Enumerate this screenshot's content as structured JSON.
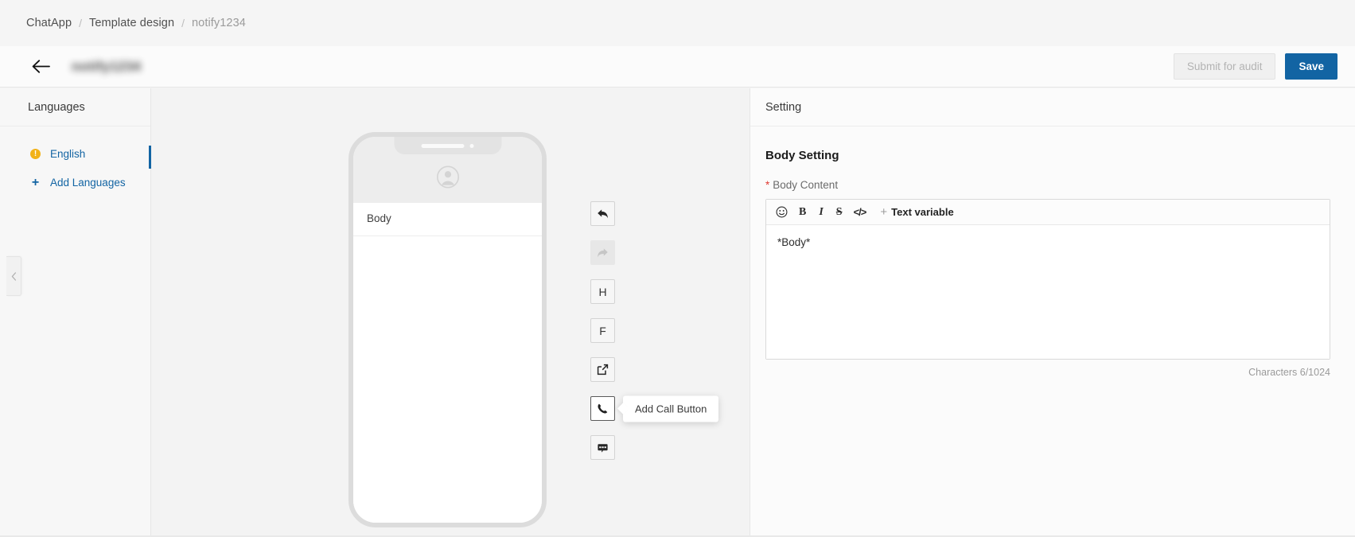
{
  "breadcrumb": {
    "items": [
      {
        "label": "ChatApp",
        "current": false
      },
      {
        "label": "Template design",
        "current": false
      },
      {
        "label": "notify1234",
        "current": true
      }
    ],
    "separator": "/"
  },
  "titlebar": {
    "back_icon": "arrow-left-icon",
    "title": "notify1234",
    "submit_label": "Submit for audit",
    "save_label": "Save",
    "primary_color": "#1264a3"
  },
  "languages": {
    "header": "Languages",
    "items": [
      {
        "label": "English",
        "status_icon": "warning-icon",
        "status_color": "#f2b218",
        "active": true
      },
      {
        "label": "Add Languages",
        "status_icon": "plus-icon",
        "status_color": "#1264a3",
        "active": false
      }
    ]
  },
  "collapse": {
    "icon": "chevron-left-icon"
  },
  "preview": {
    "avatar_icon": "user-avatar-icon",
    "body_text": "Body"
  },
  "tools": [
    {
      "name": "add-reply-button",
      "icon": "reply-arrow-icon",
      "label": "",
      "state": "default"
    },
    {
      "name": "add-forward-button",
      "icon": "forward-arrow-icon",
      "label": "",
      "state": "disabled"
    },
    {
      "name": "add-header",
      "icon": "letter-h",
      "label": "H",
      "state": "default"
    },
    {
      "name": "add-footer",
      "icon": "letter-f",
      "label": "F",
      "state": "default"
    },
    {
      "name": "add-url-button",
      "icon": "external-link-icon",
      "label": "",
      "state": "default"
    },
    {
      "name": "add-call-button",
      "icon": "phone-icon",
      "label": "",
      "state": "hovered"
    },
    {
      "name": "add-quick-reply-button",
      "icon": "chat-bubble-icon",
      "label": "",
      "state": "default"
    }
  ],
  "tooltip": {
    "text": "Add Call Button"
  },
  "setting": {
    "header": "Setting",
    "section_title": "Body Setting",
    "field_label": "Body Content",
    "required_marker": "*",
    "toolbar": {
      "emoji_icon": "emoji-smiley-icon",
      "bold": "B",
      "italic": "I",
      "strike": "S",
      "code": "</>",
      "variable_plus": "+",
      "variable_label": "Text variable"
    },
    "body_value": "*Body*",
    "char_count": "Characters 6/1024"
  }
}
